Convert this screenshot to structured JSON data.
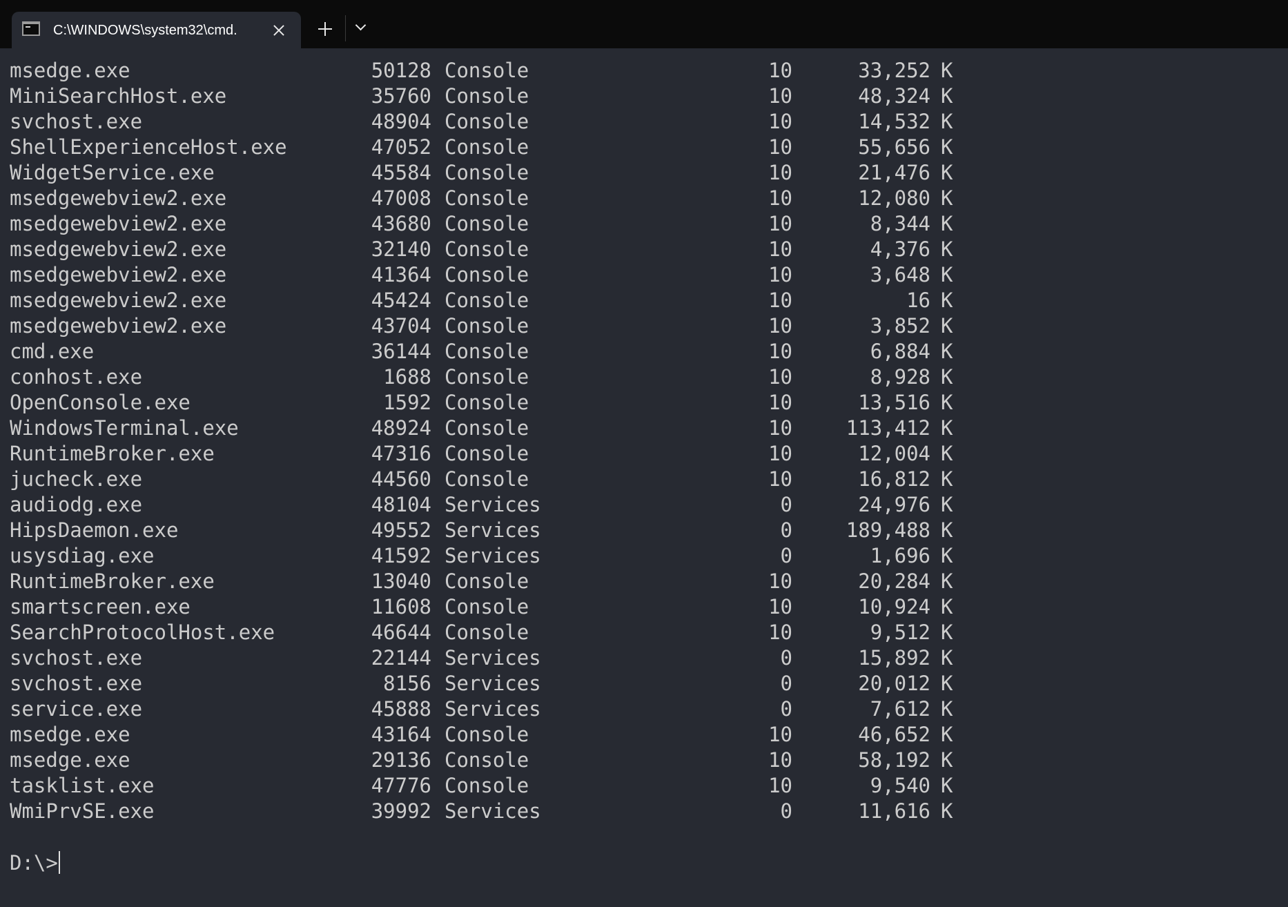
{
  "tabs": [
    {
      "title": "C:\\WINDOWS\\system32\\cmd.",
      "icon": "terminal-icon"
    }
  ],
  "tabbar": {
    "new_tab_icon": "plus-icon",
    "dropdown_icon": "chevron-down-icon",
    "close_icon": "close-icon"
  },
  "console": {
    "rows": [
      {
        "name": "msedge.exe",
        "pid": "50128",
        "session": "Console",
        "num": "10",
        "mem": "33,252",
        "unit": "K"
      },
      {
        "name": "MiniSearchHost.exe",
        "pid": "35760",
        "session": "Console",
        "num": "10",
        "mem": "48,324",
        "unit": "K"
      },
      {
        "name": "svchost.exe",
        "pid": "48904",
        "session": "Console",
        "num": "10",
        "mem": "14,532",
        "unit": "K"
      },
      {
        "name": "ShellExperienceHost.exe",
        "pid": "47052",
        "session": "Console",
        "num": "10",
        "mem": "55,656",
        "unit": "K"
      },
      {
        "name": "WidgetService.exe",
        "pid": "45584",
        "session": "Console",
        "num": "10",
        "mem": "21,476",
        "unit": "K"
      },
      {
        "name": "msedgewebview2.exe",
        "pid": "47008",
        "session": "Console",
        "num": "10",
        "mem": "12,080",
        "unit": "K"
      },
      {
        "name": "msedgewebview2.exe",
        "pid": "43680",
        "session": "Console",
        "num": "10",
        "mem": "8,344",
        "unit": "K"
      },
      {
        "name": "msedgewebview2.exe",
        "pid": "32140",
        "session": "Console",
        "num": "10",
        "mem": "4,376",
        "unit": "K"
      },
      {
        "name": "msedgewebview2.exe",
        "pid": "41364",
        "session": "Console",
        "num": "10",
        "mem": "3,648",
        "unit": "K"
      },
      {
        "name": "msedgewebview2.exe",
        "pid": "45424",
        "session": "Console",
        "num": "10",
        "mem": "16",
        "unit": "K"
      },
      {
        "name": "msedgewebview2.exe",
        "pid": "43704",
        "session": "Console",
        "num": "10",
        "mem": "3,852",
        "unit": "K"
      },
      {
        "name": "cmd.exe",
        "pid": "36144",
        "session": "Console",
        "num": "10",
        "mem": "6,884",
        "unit": "K"
      },
      {
        "name": "conhost.exe",
        "pid": "1688",
        "session": "Console",
        "num": "10",
        "mem": "8,928",
        "unit": "K"
      },
      {
        "name": "OpenConsole.exe",
        "pid": "1592",
        "session": "Console",
        "num": "10",
        "mem": "13,516",
        "unit": "K"
      },
      {
        "name": "WindowsTerminal.exe",
        "pid": "48924",
        "session": "Console",
        "num": "10",
        "mem": "113,412",
        "unit": "K"
      },
      {
        "name": "RuntimeBroker.exe",
        "pid": "47316",
        "session": "Console",
        "num": "10",
        "mem": "12,004",
        "unit": "K"
      },
      {
        "name": "jucheck.exe",
        "pid": "44560",
        "session": "Console",
        "num": "10",
        "mem": "16,812",
        "unit": "K"
      },
      {
        "name": "audiodg.exe",
        "pid": "48104",
        "session": "Services",
        "num": "0",
        "mem": "24,976",
        "unit": "K"
      },
      {
        "name": "HipsDaemon.exe",
        "pid": "49552",
        "session": "Services",
        "num": "0",
        "mem": "189,488",
        "unit": "K"
      },
      {
        "name": "usysdiag.exe",
        "pid": "41592",
        "session": "Services",
        "num": "0",
        "mem": "1,696",
        "unit": "K"
      },
      {
        "name": "RuntimeBroker.exe",
        "pid": "13040",
        "session": "Console",
        "num": "10",
        "mem": "20,284",
        "unit": "K"
      },
      {
        "name": "smartscreen.exe",
        "pid": "11608",
        "session": "Console",
        "num": "10",
        "mem": "10,924",
        "unit": "K"
      },
      {
        "name": "SearchProtocolHost.exe",
        "pid": "46644",
        "session": "Console",
        "num": "10",
        "mem": "9,512",
        "unit": "K"
      },
      {
        "name": "svchost.exe",
        "pid": "22144",
        "session": "Services",
        "num": "0",
        "mem": "15,892",
        "unit": "K"
      },
      {
        "name": "svchost.exe",
        "pid": "8156",
        "session": "Services",
        "num": "0",
        "mem": "20,012",
        "unit": "K"
      },
      {
        "name": "service.exe",
        "pid": "45888",
        "session": "Services",
        "num": "0",
        "mem": "7,612",
        "unit": "K"
      },
      {
        "name": "msedge.exe",
        "pid": "43164",
        "session": "Console",
        "num": "10",
        "mem": "46,652",
        "unit": "K"
      },
      {
        "name": "msedge.exe",
        "pid": "29136",
        "session": "Console",
        "num": "10",
        "mem": "58,192",
        "unit": "K"
      },
      {
        "name": "tasklist.exe",
        "pid": "47776",
        "session": "Console",
        "num": "10",
        "mem": "9,540",
        "unit": "K"
      },
      {
        "name": "WmiPrvSE.exe",
        "pid": "39992",
        "session": "Services",
        "num": "0",
        "mem": "11,616",
        "unit": "K"
      }
    ],
    "prompt": "D:\\>"
  },
  "colors": {
    "titlebar_bg": "#0b0b0b",
    "console_bg": "#272a32",
    "console_fg": "#cccccc",
    "tab_text": "#ffffff"
  }
}
